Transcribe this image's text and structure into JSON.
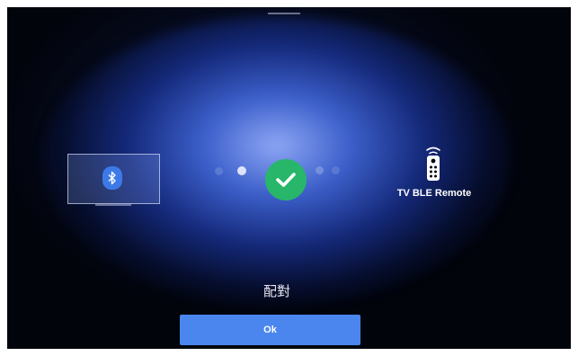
{
  "pairing": {
    "device_name": "TV BLE Remote",
    "status_text": "配對",
    "steps_left": 2,
    "steps_right": 2
  },
  "buttons": {
    "ok_label": "Ok"
  },
  "icons": {
    "source": "bluetooth-icon",
    "status": "checkmark-icon",
    "target": "remote-control-icon"
  },
  "colors": {
    "accent": "#4a86ee",
    "success": "#28b66a",
    "bluetooth": "#3d7ae8",
    "background": "#02040c"
  }
}
